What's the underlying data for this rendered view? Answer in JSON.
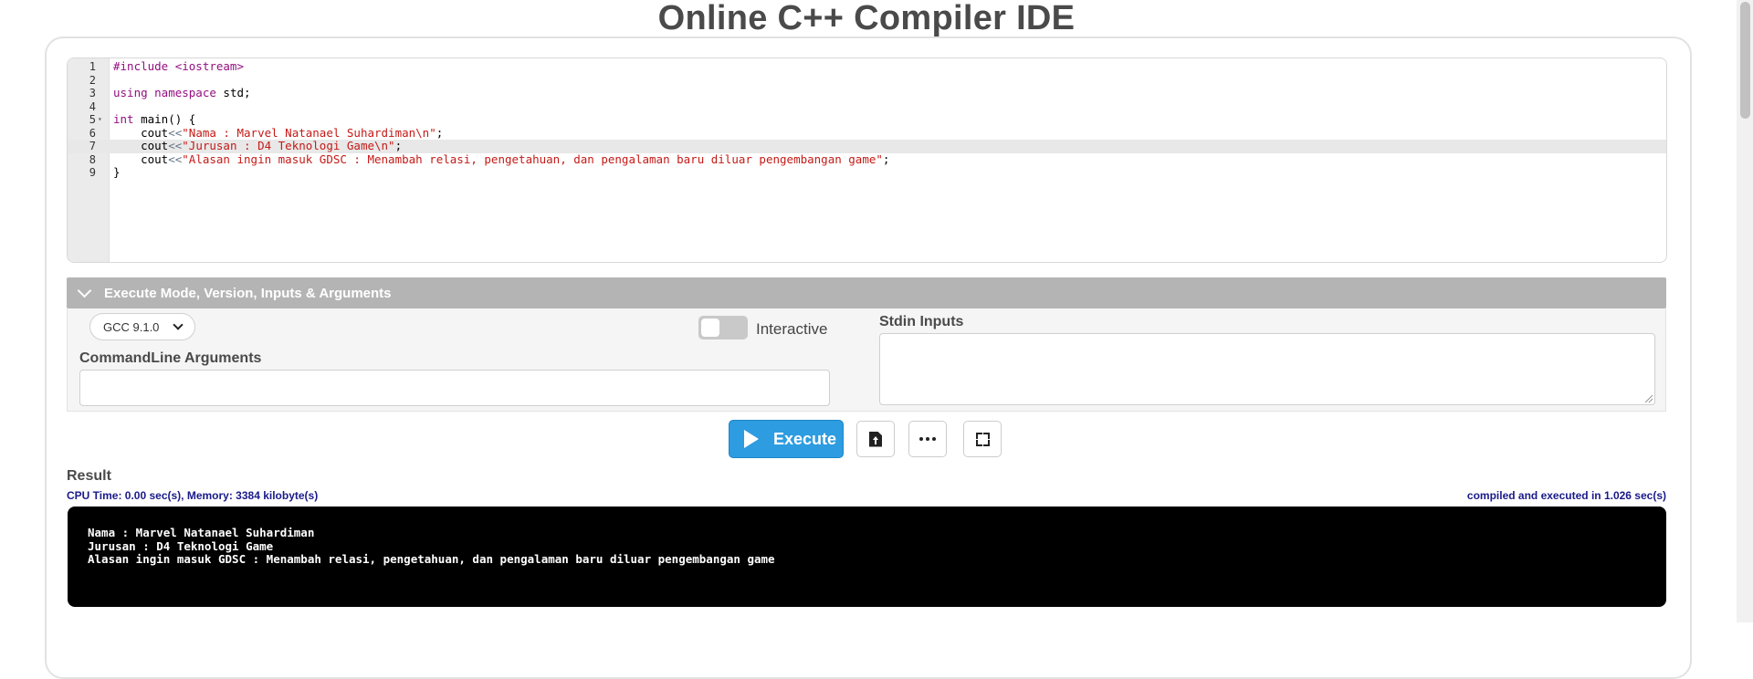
{
  "page": {
    "title": "Online C++ Compiler IDE"
  },
  "editor": {
    "lines": [
      {
        "num": "1",
        "fold": "",
        "active": false,
        "tokens": [
          {
            "t": "#include <iostream>",
            "c": "kw"
          }
        ]
      },
      {
        "num": "2",
        "fold": "",
        "active": false,
        "tokens": []
      },
      {
        "num": "3",
        "fold": "",
        "active": false,
        "tokens": [
          {
            "t": "using namespace",
            "c": "kw"
          },
          {
            "t": " std;",
            "c": ""
          }
        ]
      },
      {
        "num": "4",
        "fold": "",
        "active": false,
        "tokens": []
      },
      {
        "num": "5",
        "fold": "▾",
        "active": false,
        "tokens": [
          {
            "t": "int",
            "c": "kw"
          },
          {
            "t": " main() {",
            "c": ""
          }
        ]
      },
      {
        "num": "6",
        "fold": "",
        "active": false,
        "tokens": [
          {
            "t": "    cout",
            "c": ""
          },
          {
            "t": "<<",
            "c": "op"
          },
          {
            "t": "\"Nama : Marvel Natanael Suhardiman\\n\"",
            "c": "str"
          },
          {
            "t": ";",
            "c": ""
          }
        ]
      },
      {
        "num": "7",
        "fold": "",
        "active": true,
        "tokens": [
          {
            "t": "    cout",
            "c": ""
          },
          {
            "t": "<<",
            "c": "op"
          },
          {
            "t": "\"Jurusan : D4 Teknologi Game\\n\"",
            "c": "str"
          },
          {
            "t": ";",
            "c": ""
          }
        ]
      },
      {
        "num": "8",
        "fold": "",
        "active": false,
        "tokens": [
          {
            "t": "    cout",
            "c": ""
          },
          {
            "t": "<<",
            "c": "op"
          },
          {
            "t": "\"Alasan ingin masuk GDSC : Menambah relasi, pengetahuan, dan pengalaman baru diluar pengembangan game\"",
            "c": "str"
          },
          {
            "t": ";",
            "c": ""
          }
        ]
      },
      {
        "num": "9",
        "fold": "",
        "active": false,
        "tokens": [
          {
            "t": "}",
            "c": ""
          }
        ]
      }
    ]
  },
  "execute_panel": {
    "header": "Execute Mode, Version, Inputs & Arguments",
    "version": "GCC 9.1.0",
    "interactive_label": "Interactive",
    "interactive_on": false,
    "cmdline_label": "CommandLine Arguments",
    "cmdline_value": "",
    "stdin_label": "Stdin Inputs",
    "stdin_value": ""
  },
  "toolbar": {
    "execute_label": "Execute",
    "icons": [
      "upload-file-icon",
      "more-options-icon",
      "fullscreen-icon"
    ]
  },
  "result": {
    "label": "Result",
    "cpu_stats": "CPU Time: 0.00 sec(s), Memory: 3384 kilobyte(s)",
    "compile_stats": "compiled and executed in 1.026 sec(s)",
    "output_lines": [
      "Nama : Marvel Natanael Suhardiman",
      "Jurusan : D4 Teknologi Game",
      "Alasan ingin masuk GDSC : Menambah relasi, pengetahuan, dan pengalaman baru diluar pengembangan game"
    ]
  },
  "colors": {
    "accent": "#2e9ce0",
    "header_bg": "#b4b4b4",
    "output_bg": "#000000",
    "keyword": "#930f80",
    "string": "#c41a16",
    "stats_text": "#1a1a8a"
  }
}
